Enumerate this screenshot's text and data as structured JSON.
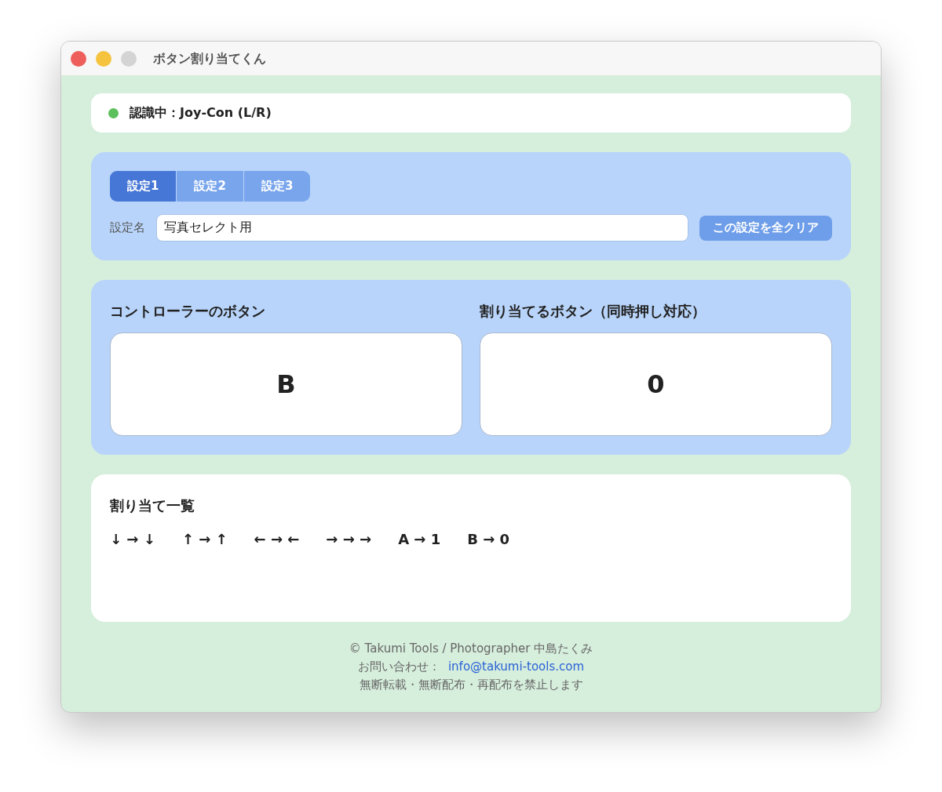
{
  "window": {
    "title": "ボタン割り当てくん"
  },
  "status": {
    "text": "認識中：Joy-Con (L/R)",
    "color": "#5cc05c"
  },
  "tabs": [
    {
      "label": "設定1",
      "selected": true
    },
    {
      "label": "設定2",
      "selected": false
    },
    {
      "label": "設定3",
      "selected": false
    }
  ],
  "setting_name": {
    "label": "設定名",
    "value": "写真セレクト用"
  },
  "clear_button": "この設定を全クリア",
  "controller": {
    "heading": "コントローラーのボタン",
    "value": "B"
  },
  "assign": {
    "heading": "割り当てるボタン（同時押し対応）",
    "value": "0"
  },
  "mapping_list": {
    "heading": "割り当て一覧",
    "items": [
      "↓ → ↓",
      "↑ → ↑",
      "← → ←",
      "→ → →",
      "A → 1",
      "B → 0"
    ]
  },
  "footer": {
    "copyright": "© Takumi Tools / Photographer 中島たくみ",
    "contact_label": "お問い合わせ：",
    "email": "info@takumi-tools.com",
    "notice": "無断転載・無断配布・再配布を禁止します"
  }
}
